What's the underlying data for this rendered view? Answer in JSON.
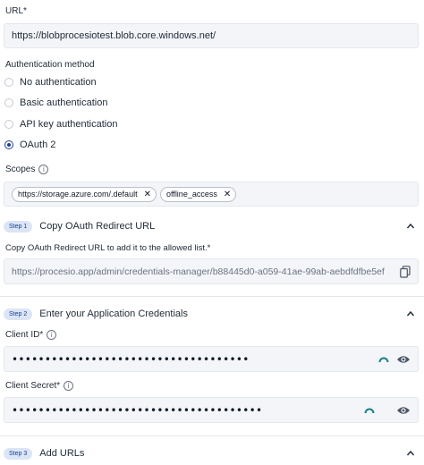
{
  "url": {
    "label": "URL",
    "required": "*",
    "value": "https://blobprocesiotest.blob.core.windows.net/"
  },
  "auth": {
    "label": "Authentication method",
    "options": [
      {
        "label": "No authentication",
        "checked": false
      },
      {
        "label": "Basic authentication",
        "checked": false
      },
      {
        "label": "API key authentication",
        "checked": false
      },
      {
        "label": "OAuth 2",
        "checked": true
      }
    ]
  },
  "scopes": {
    "label": "Scopes",
    "info_icon": "info-icon",
    "chips": [
      "https://storage.azure.com/.default",
      "offline_access"
    ]
  },
  "step1": {
    "badge": "Step 1",
    "title": "Copy OAuth Redirect URL",
    "field_label": "Copy OAuth Redirect URL to add it to the allowed list.*",
    "redirect_url": "https://procesio.app/admin/credentials-manager/b88445d0-a059-41ae-99ab-aebdfdfbe5ef"
  },
  "step2": {
    "badge": "Step 2",
    "title": "Enter your Application Credentials",
    "client_id_label": "Client ID*",
    "client_id_value": "••••••••••••••••••••••••••••••••••••",
    "client_secret_label": "Client Secret*",
    "client_secret_value": "••••••••••••••••••••••••••••••••••••••"
  },
  "step3": {
    "badge": "Step 3",
    "title": "Add URLs"
  },
  "colors": {
    "accent": "#1b3f8f",
    "badge_bg": "#dbe5f6",
    "field_bg": "#f3f5f8",
    "spinner": "#1a7f86"
  }
}
